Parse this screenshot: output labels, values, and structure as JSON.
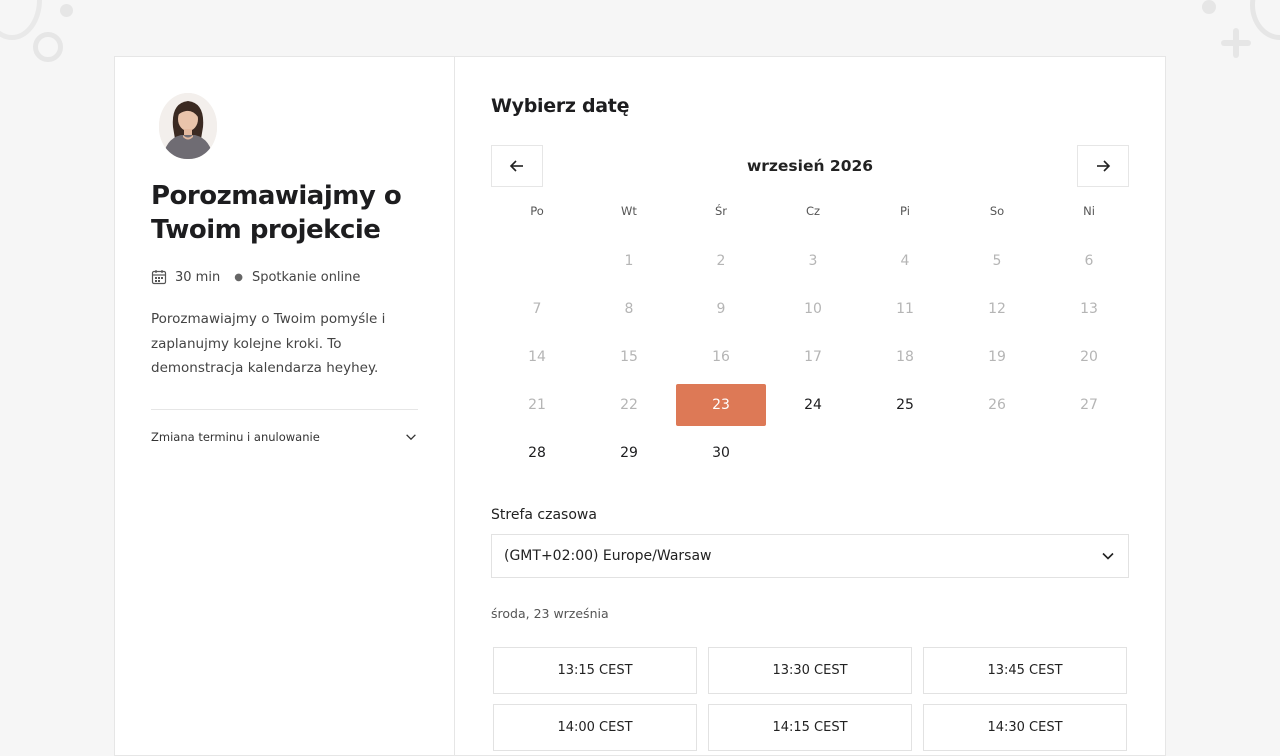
{
  "host": {
    "title": "Porozmawiajmy o Twoim projekcie",
    "duration": "30 min",
    "meeting_type": "Spotkanie online",
    "description": "Porozmawiajmy o Twoim pomyśle i zaplanujmy kolejne kroki. To demonstracja kalendarza heyhey.",
    "reschedule_label": "Zmiana terminu i anulowanie"
  },
  "calendar": {
    "section_title": "Wybierz datę",
    "month_label": "wrzesień 2026",
    "weekdays": [
      "Po",
      "Wt",
      "Śr",
      "Cz",
      "Pi",
      "So",
      "Ni"
    ],
    "weeks": [
      [
        {
          "d": ""
        },
        {
          "d": "1"
        },
        {
          "d": "2"
        },
        {
          "d": "3"
        },
        {
          "d": "4"
        },
        {
          "d": "5"
        },
        {
          "d": "6"
        }
      ],
      [
        {
          "d": "7"
        },
        {
          "d": "8"
        },
        {
          "d": "9"
        },
        {
          "d": "10"
        },
        {
          "d": "11"
        },
        {
          "d": "12"
        },
        {
          "d": "13"
        }
      ],
      [
        {
          "d": "14"
        },
        {
          "d": "15"
        },
        {
          "d": "16"
        },
        {
          "d": "17"
        },
        {
          "d": "18"
        },
        {
          "d": "19"
        },
        {
          "d": "20"
        }
      ],
      [
        {
          "d": "21"
        },
        {
          "d": "22"
        },
        {
          "d": "23",
          "state": "selected"
        },
        {
          "d": "24",
          "state": "available"
        },
        {
          "d": "25",
          "state": "available"
        },
        {
          "d": "26"
        },
        {
          "d": "27"
        }
      ],
      [
        {
          "d": "28",
          "state": "available"
        },
        {
          "d": "29",
          "state": "available"
        },
        {
          "d": "30",
          "state": "available"
        },
        {
          "d": ""
        },
        {
          "d": ""
        },
        {
          "d": ""
        },
        {
          "d": ""
        }
      ]
    ]
  },
  "timezone": {
    "label": "Strefa czasowa",
    "value": "(GMT+02:00) Europe/Warsaw"
  },
  "selected_date_label": "środa, 23 września",
  "slots": [
    "13:15 CEST",
    "13:30 CEST",
    "13:45 CEST",
    "14:00 CEST",
    "14:15 CEST",
    "14:30 CEST"
  ],
  "colors": {
    "accent": "#dd7956",
    "border": "#e6e6e6",
    "muted_day": "#b5b5b5"
  },
  "icons": {
    "calendar": "calendar-icon",
    "prev": "arrow-left-icon",
    "next": "arrow-right-icon",
    "chevron": "chevron-down-icon"
  }
}
